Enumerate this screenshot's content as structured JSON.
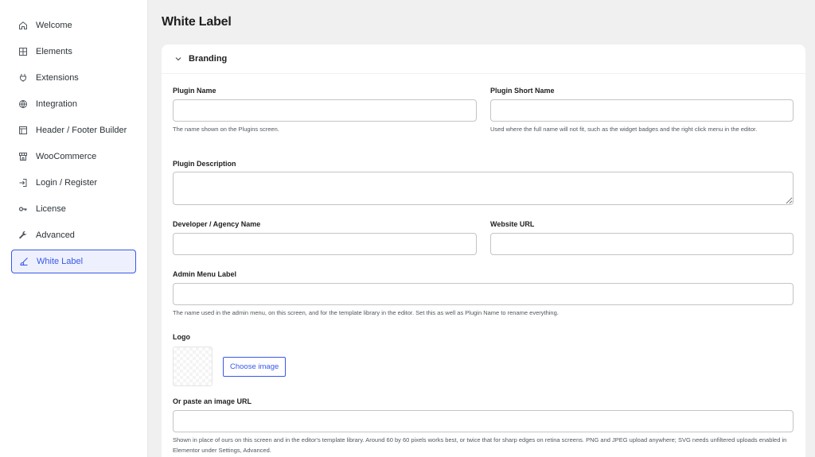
{
  "sidebar": {
    "items": [
      {
        "label": "Welcome",
        "icon": "home-icon"
      },
      {
        "label": "Elements",
        "icon": "grid-icon"
      },
      {
        "label": "Extensions",
        "icon": "plug-icon"
      },
      {
        "label": "Integration",
        "icon": "globe-icon"
      },
      {
        "label": "Header / Footer Builder",
        "icon": "layout-icon"
      },
      {
        "label": "WooCommerce",
        "icon": "store-icon"
      },
      {
        "label": "Login / Register",
        "icon": "login-icon"
      },
      {
        "label": "License",
        "icon": "key-icon"
      },
      {
        "label": "Advanced",
        "icon": "wrench-icon"
      },
      {
        "label": "White Label",
        "icon": "brush-icon",
        "active": true
      }
    ]
  },
  "page": {
    "title": "White Label"
  },
  "section": {
    "title": "Branding"
  },
  "fields": {
    "plugin_name": {
      "label": "Plugin Name",
      "value": "",
      "help": "The name shown on the Plugins screen."
    },
    "plugin_short_name": {
      "label": "Plugin Short Name",
      "value": "",
      "help": "Used where the full name will not fit, such as the widget badges and the right click menu in the editor."
    },
    "plugin_description": {
      "label": "Plugin Description",
      "value": ""
    },
    "developer_name": {
      "label": "Developer / Agency Name",
      "value": ""
    },
    "website_url": {
      "label": "Website URL",
      "value": ""
    },
    "admin_menu_label": {
      "label": "Admin Menu Label",
      "value": "",
      "help": "The name used in the admin menu, on this screen, and for the template library in the editor. Set this as well as Plugin Name to rename everything."
    },
    "logo": {
      "label": "Logo",
      "button": "Choose image"
    },
    "image_url": {
      "label": "Or paste an image URL",
      "value": "",
      "help": "Shown in place of ours on this screen and in the editor's template library. Around 60 by 60 pixels works best, or twice that for sharp edges on retina screens. PNG and JPEG upload anywhere; SVG needs unfiltered uploads enabled in Elementor under Settings, Advanced."
    }
  },
  "colors": {
    "accent": "#3858e9",
    "background": "#f0f0f1"
  }
}
